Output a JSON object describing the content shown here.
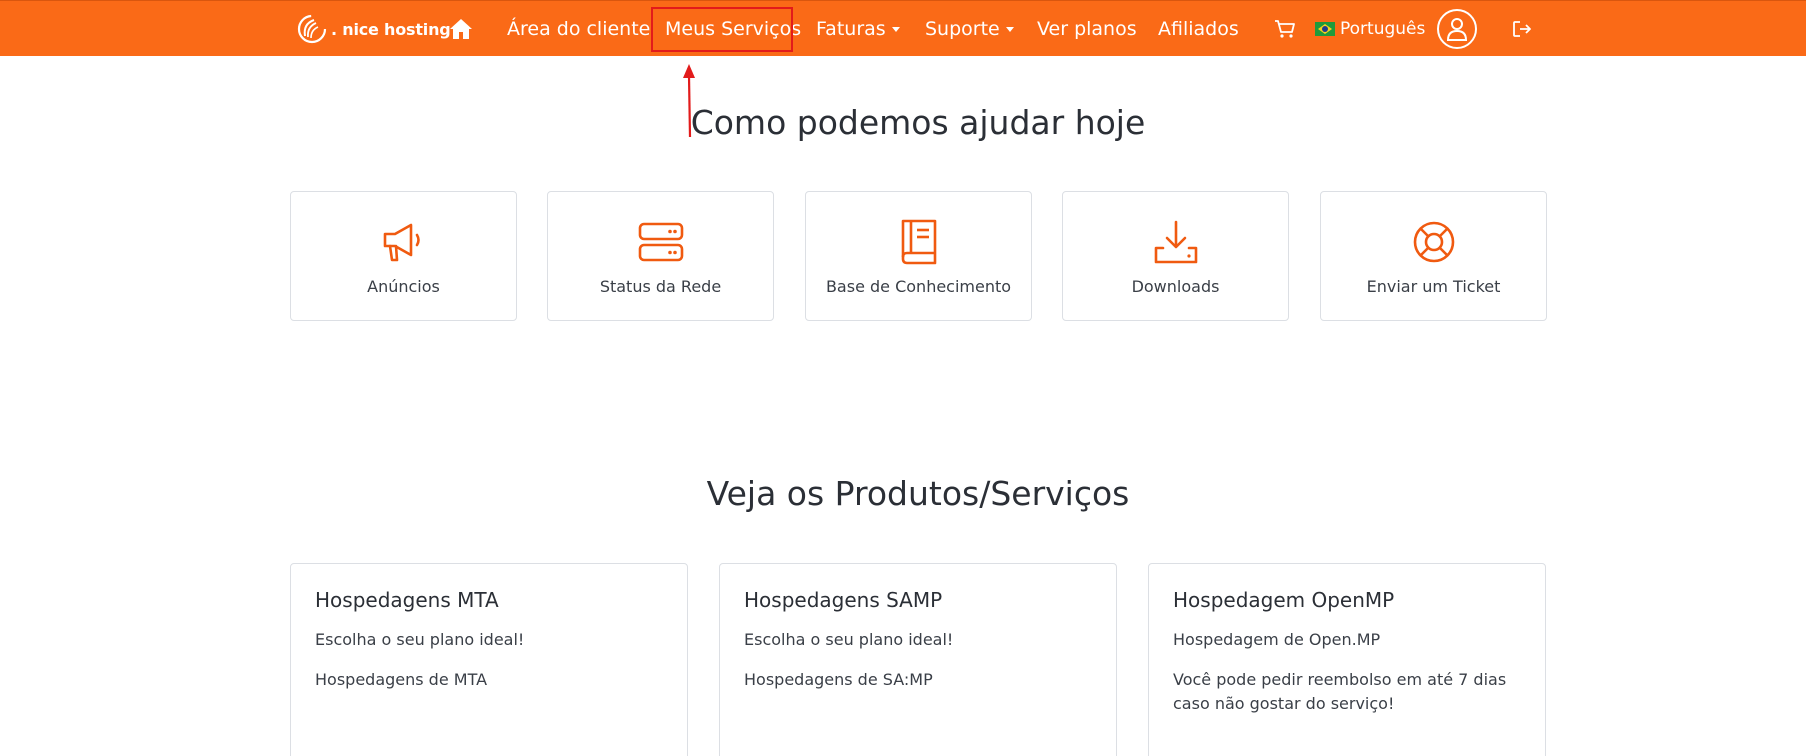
{
  "colors": {
    "brand": "#fa6a17",
    "annotation": "#e21b1b",
    "icon": "#f05a10"
  },
  "navbar": {
    "logo_text": ". nice hosting",
    "items": [
      {
        "label": "Área do cliente"
      },
      {
        "label": "Meus Serviços"
      },
      {
        "label": "Faturas"
      },
      {
        "label": "Suporte"
      },
      {
        "label": "Ver planos"
      },
      {
        "label": "Afiliados"
      }
    ],
    "language": "Português"
  },
  "help": {
    "heading": "Como podemos ajudar hoje",
    "tiles": [
      {
        "label": "Anúncios",
        "icon": "megaphone-icon"
      },
      {
        "label": "Status da Rede",
        "icon": "server-icon"
      },
      {
        "label": "Base de Conhecimento",
        "icon": "book-icon"
      },
      {
        "label": "Downloads",
        "icon": "download-icon"
      },
      {
        "label": "Enviar um Ticket",
        "icon": "lifebuoy-icon"
      }
    ]
  },
  "products": {
    "heading": "Veja os Produtos/Serviços",
    "cards": [
      {
        "title": "Hospedagens MTA",
        "lines": [
          "Escolha o seu plano ideal!",
          "Hospedagens de MTA"
        ]
      },
      {
        "title": "Hospedagens SAMP",
        "lines": [
          "Escolha o seu plano ideal!",
          "Hospedagens de SA:MP"
        ]
      },
      {
        "title": "Hospedagem OpenMP",
        "lines": [
          "Hospedagem de Open.MP",
          "Você pode pedir reembolso em até 7 dias caso não gostar do serviço!"
        ]
      }
    ]
  }
}
